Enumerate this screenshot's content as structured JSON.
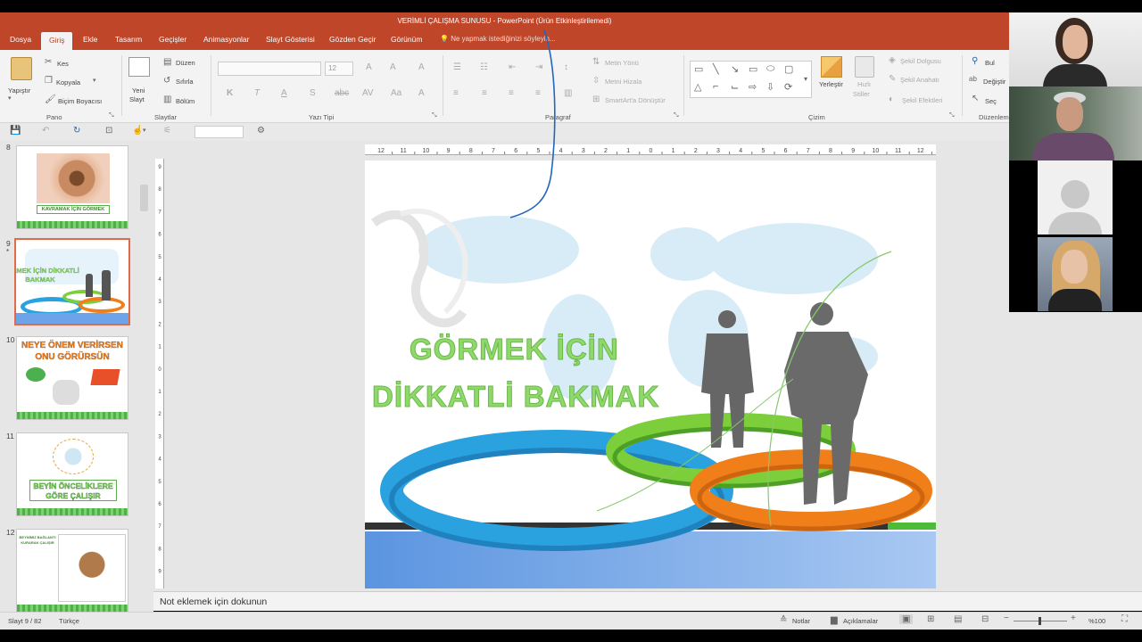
{
  "window": {
    "title": "VERİMLİ ÇALIŞMA SUNUSU - PowerPoint (Ürün Etkinleştirilemedi)"
  },
  "tabs": [
    "Dosya",
    "Giriş",
    "Ekle",
    "Tasarım",
    "Geçişler",
    "Animasyonlar",
    "Slayt Gösterisi",
    "Gözden Geçir",
    "Görünüm"
  ],
  "active_tab": "Giriş",
  "tell_me": "Ne yapmak istediğinizi söyleyin...",
  "ribbon": {
    "paste": "Yapıştır",
    "cut": "Kes",
    "copy": "Kopyala",
    "format_painter": "Biçim Boyacısı",
    "new_slide_1": "Yeni",
    "new_slide_2": "Slayt",
    "layout": "Düzen",
    "reset": "Sıfırla",
    "section": "Bölüm",
    "font_size": "12",
    "text_direction": "Metin Yönü",
    "align_text": "Metni Hizala",
    "smartart": "SmartArt'a Dönüştür",
    "arrange": "Yerleştir",
    "quick_styles_1": "Hızlı",
    "quick_styles_2": "Stiller",
    "shape_fill": "Şekil Dolgusu",
    "shape_outline": "Şekil Anahatı",
    "shape_effects": "Şekil Efektleri",
    "find": "Bul",
    "replace": "Değiştir",
    "select": "Seç",
    "groups": {
      "clipboard": "Pano",
      "slides": "Slaytlar",
      "font": "Yazı Tipi",
      "paragraph": "Paragraf",
      "drawing": "Çizim",
      "editing": "Düzenleme"
    }
  },
  "slides": [
    {
      "num": "8",
      "text": "KAVRAMAK İÇİN GÖRMEK"
    },
    {
      "num": "9",
      "text": "GÖRMEK İÇİN DİKKATLİ BAKMAK",
      "selected": true
    },
    {
      "num": "10",
      "text": "NEYE ÖNEM VERİRSEN ONU GÖRÜRSÜN"
    },
    {
      "num": "11",
      "text": "BEYİN ÖNCELİKLERE GÖRE ÇALIŞIR"
    },
    {
      "num": "12",
      "text": "BEYNİMİZ BAĞLANTI KURARAK ÇALIŞIR"
    }
  ],
  "slide": {
    "line1": "GÖRMEK İÇİN",
    "line2": "DİKKATLİ BAKMAK"
  },
  "notes_placeholder": "Not eklemek için dokunun",
  "status": {
    "slide": "Slayt 9 / 82",
    "language": "Türkçe",
    "notes": "Notlar",
    "comments": "Açıklamalar",
    "zoom": "%100"
  },
  "colors": {
    "accent": "#c0462a",
    "title_green": "#8fd96a",
    "ring_blue": "#2aa2e0",
    "ring_green": "#7ccf3a",
    "ring_orange": "#f07f1a"
  }
}
